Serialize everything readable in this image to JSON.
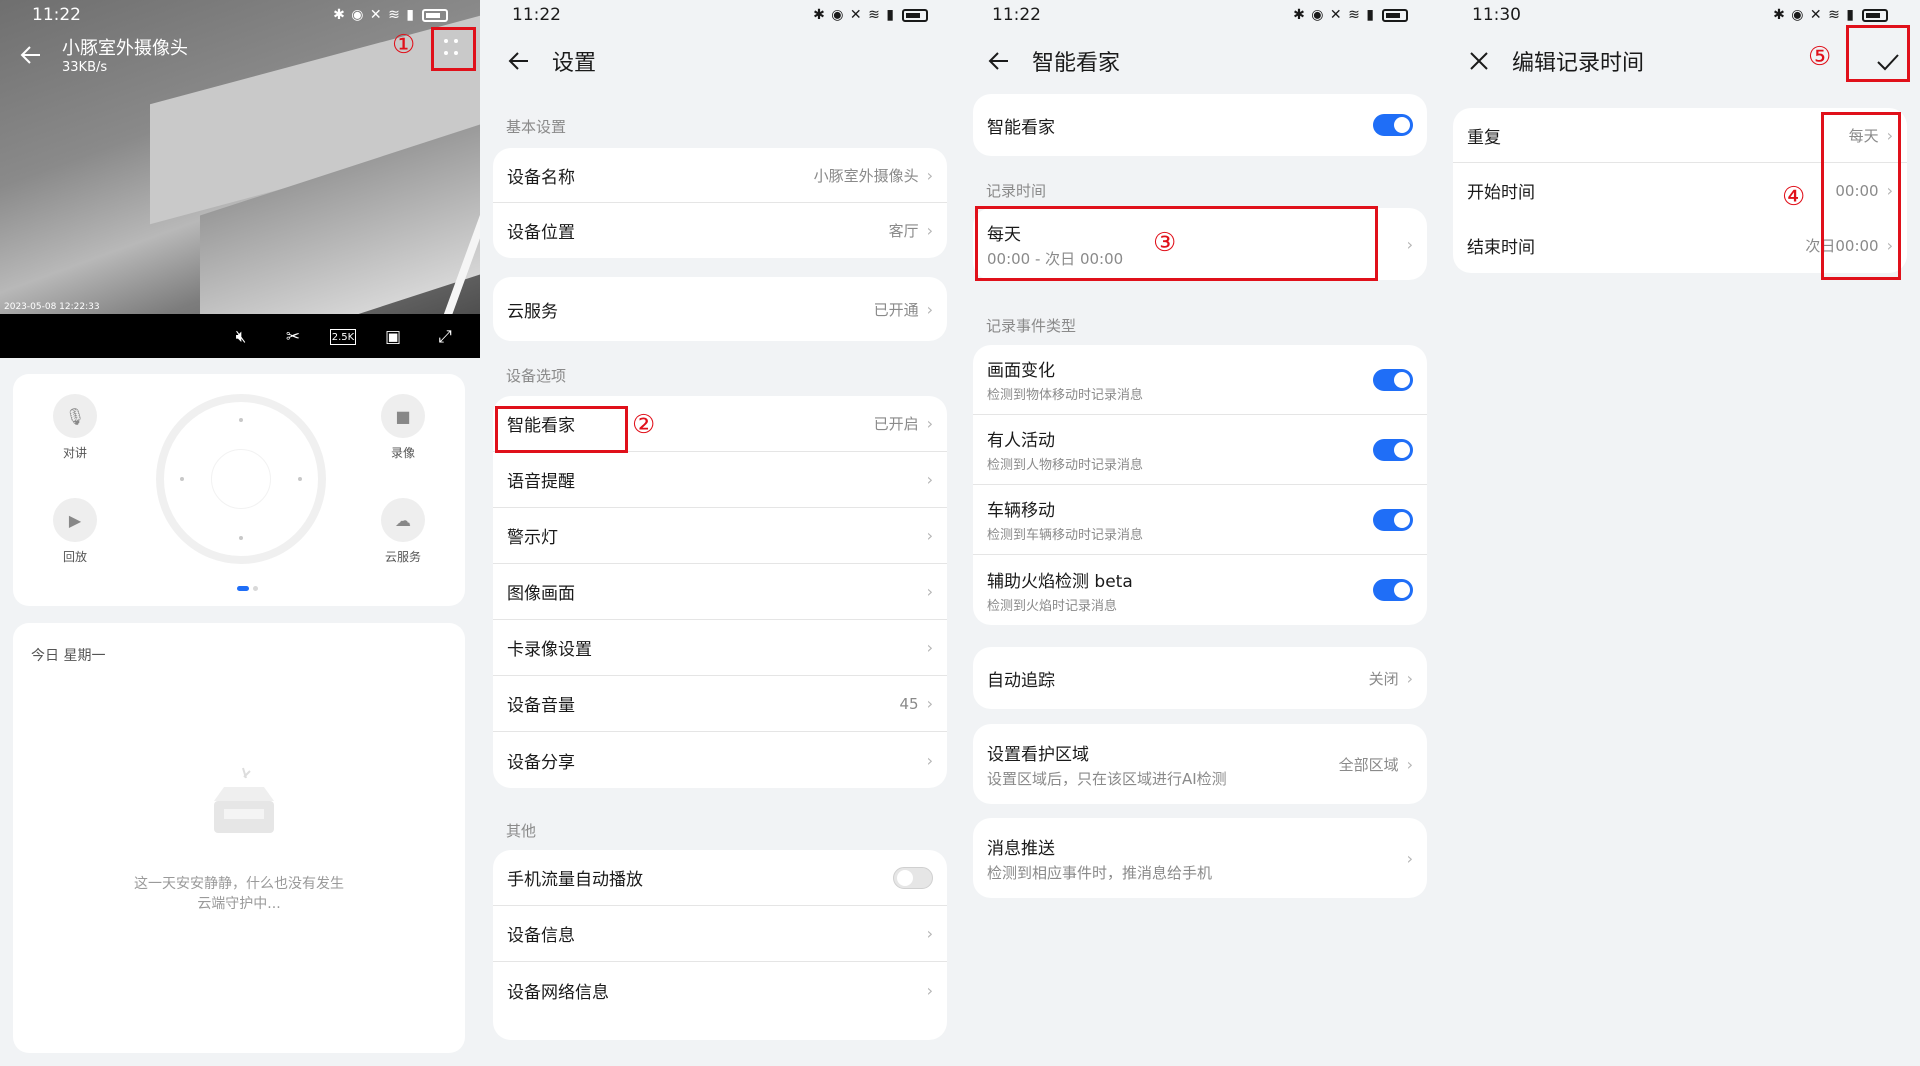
{
  "status_bar": {
    "p1_time": "11:22",
    "p2_time": "11:22",
    "p3_time": "11:22",
    "p4_time": "11:30",
    "icons": "✱ ◉ ✕ ≋ ▮"
  },
  "p1": {
    "camera_name": "小豚室外摄像头",
    "speed": "33KB/s",
    "timestamp": "2023-05-08 12:22:33",
    "hd_label": "2.5K",
    "controls": {
      "talk": "对讲",
      "record": "录像",
      "playback": "回放",
      "cloud": "云服务"
    },
    "today_label": "今日 星期一",
    "empty_line1": "这一天安安静静，什么也没有发生",
    "empty_line2": "云端守护中...",
    "step": "①"
  },
  "p2": {
    "title": "设置",
    "section_basic": "基本设置",
    "device_name_label": "设备名称",
    "device_name_value": "小豚室外摄像头",
    "device_location_label": "设备位置",
    "device_location_value": "客厅",
    "cloud_label": "云服务",
    "cloud_value": "已开通",
    "section_options": "设备选项",
    "smart_label": "智能看家",
    "smart_value": "已开启",
    "voice_label": "语音提醒",
    "warning_light_label": "警示灯",
    "image_label": "图像画面",
    "card_record_label": "卡录像设置",
    "volume_label": "设备音量",
    "volume_value": "45",
    "share_label": "设备分享",
    "section_other": "其他",
    "autoplay_label": "手机流量自动播放",
    "device_info_label": "设备信息",
    "network_info_label": "设备网络信息",
    "step": "②"
  },
  "p3": {
    "title": "智能看家",
    "smart_label": "智能看家",
    "section_record_time": "记录时间",
    "record_day": "每天",
    "record_range": "00:00 - 次日 00:00",
    "section_event_types": "记录事件类型",
    "events": [
      {
        "title": "画面变化",
        "desc": "检测到物体移动时记录消息"
      },
      {
        "title": "有人活动",
        "desc": "检测到人物移动时记录消息"
      },
      {
        "title": "车辆移动",
        "desc": "检测到车辆移动时记录消息"
      },
      {
        "title": "辅助火焰检测 beta",
        "desc": "检测到火焰时记录消息"
      }
    ],
    "auto_track_label": "自动追踪",
    "auto_track_value": "关闭",
    "guard_zone_label": "设置看护区域",
    "guard_zone_desc": "设置区域后，只在该区域进行AI检测",
    "guard_zone_value": "全部区域",
    "push_label": "消息推送",
    "push_desc": "检测到相应事件时，推消息给手机",
    "step": "③"
  },
  "p4": {
    "title": "编辑记录时间",
    "repeat_label": "重复",
    "repeat_value": "每天",
    "start_label": "开始时间",
    "start_value": "00:00",
    "end_label": "结束时间",
    "end_value": "次日00:00",
    "step4": "④",
    "step5": "⑤"
  },
  "colors": {
    "accent": "#1f6ef7",
    "highlight": "#e0101a"
  }
}
